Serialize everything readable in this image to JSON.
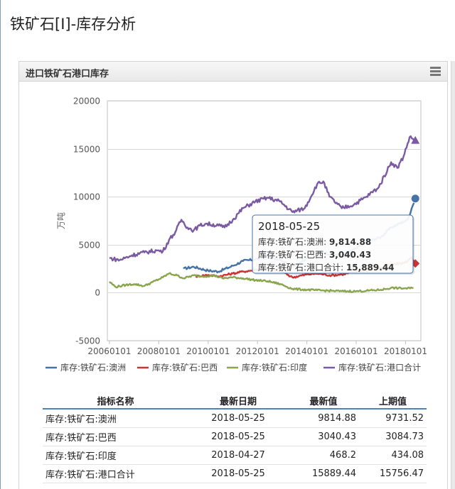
{
  "page": {
    "title": "铁矿石[I]-库存分析"
  },
  "panel": {
    "title": "进口铁矿石港口库存",
    "menu_icon": "menu-icon"
  },
  "chart_data": {
    "type": "line",
    "ylabel": "万吨",
    "ylim": [
      -5000,
      20000
    ],
    "yticks": [
      -5000,
      0,
      5000,
      10000,
      15000,
      20000
    ],
    "xlim": [
      "2005-12-01",
      "2018-08-15"
    ],
    "xticks": [
      "20060101",
      "20080101",
      "20100101",
      "20120101",
      "20140101",
      "20160101",
      "20180101"
    ],
    "grid": true,
    "legend_position": "bottom",
    "series": [
      {
        "name": "库存:铁矿石:澳洲",
        "color": "#4572a7",
        "marker": "circle",
        "points": [
          [
            "2009-01-01",
            2500
          ],
          [
            "2009-06-01",
            2700
          ],
          [
            "2010-01-01",
            2300
          ],
          [
            "2010-06-01",
            2200
          ],
          [
            "2011-01-01",
            2800
          ],
          [
            "2011-06-01",
            3300
          ],
          [
            "2012-01-01",
            3500
          ],
          [
            "2012-06-01",
            3800
          ],
          [
            "2013-01-01",
            3300
          ],
          [
            "2013-06-01",
            2700
          ],
          [
            "2014-01-01",
            3600
          ],
          [
            "2014-06-01",
            4300
          ],
          [
            "2015-01-01",
            4000
          ],
          [
            "2015-06-01",
            3900
          ],
          [
            "2016-01-01",
            4600
          ],
          [
            "2016-06-01",
            5300
          ],
          [
            "2017-01-01",
            5800
          ],
          [
            "2017-06-01",
            6800
          ],
          [
            "2017-12-01",
            7400
          ],
          [
            "2018-02-01",
            7600
          ],
          [
            "2018-04-01",
            8800
          ],
          [
            "2018-05-25",
            9814.88
          ]
        ]
      },
      {
        "name": "库存:铁矿石:巴西",
        "color": "#cc3333",
        "marker": "diamond",
        "points": [
          [
            "2009-07-01",
            1700
          ],
          [
            "2010-01-01",
            1850
          ],
          [
            "2010-06-01",
            1700
          ],
          [
            "2011-01-01",
            2000
          ],
          [
            "2011-06-01",
            2200
          ],
          [
            "2012-01-01",
            2400
          ],
          [
            "2012-06-01",
            2500
          ],
          [
            "2013-01-01",
            2200
          ],
          [
            "2013-06-01",
            1600
          ],
          [
            "2014-01-01",
            1900
          ],
          [
            "2014-06-01",
            2000
          ],
          [
            "2015-01-01",
            1800
          ],
          [
            "2015-06-01",
            1900
          ],
          [
            "2016-01-01",
            2200
          ],
          [
            "2016-06-01",
            2300
          ],
          [
            "2017-01-01",
            2600
          ],
          [
            "2017-06-01",
            2900
          ],
          [
            "2017-12-01",
            3100
          ],
          [
            "2018-02-01",
            3300
          ],
          [
            "2018-04-01",
            3700
          ],
          [
            "2018-05-25",
            3040.43
          ]
        ]
      },
      {
        "name": "库存:铁矿石:印度",
        "color": "#89a54e",
        "marker": "none",
        "points": [
          [
            "2006-01-01",
            1150
          ],
          [
            "2006-04-01",
            600
          ],
          [
            "2006-09-01",
            800
          ],
          [
            "2007-01-01",
            900
          ],
          [
            "2007-06-01",
            700
          ],
          [
            "2007-10-01",
            1100
          ],
          [
            "2008-03-01",
            1600
          ],
          [
            "2008-06-01",
            2000
          ],
          [
            "2008-10-01",
            1800
          ],
          [
            "2009-01-01",
            1500
          ],
          [
            "2009-06-01",
            1800
          ],
          [
            "2009-10-01",
            1700
          ],
          [
            "2010-04-01",
            1800
          ],
          [
            "2010-08-01",
            1500
          ],
          [
            "2011-01-01",
            1600
          ],
          [
            "2011-06-01",
            1500
          ],
          [
            "2011-12-01",
            1300
          ],
          [
            "2012-06-01",
            1200
          ],
          [
            "2012-12-01",
            900
          ],
          [
            "2013-06-01",
            400
          ],
          [
            "2014-01-01",
            300
          ],
          [
            "2014-06-01",
            250
          ],
          [
            "2015-01-01",
            200
          ],
          [
            "2015-06-01",
            150
          ],
          [
            "2016-01-01",
            150
          ],
          [
            "2016-06-01",
            200
          ],
          [
            "2017-01-01",
            300
          ],
          [
            "2017-06-01",
            500
          ],
          [
            "2017-12-01",
            450
          ],
          [
            "2018-04-27",
            468.2
          ]
        ]
      },
      {
        "name": "库存:铁矿石:港口合计",
        "color": "#7a5aa3",
        "marker": "triangle",
        "points": [
          [
            "2006-01-01",
            3600
          ],
          [
            "2006-06-01",
            3400
          ],
          [
            "2006-12-01",
            3900
          ],
          [
            "2007-06-01",
            4200
          ],
          [
            "2007-12-01",
            4400
          ],
          [
            "2008-03-01",
            4300
          ],
          [
            "2008-06-01",
            5500
          ],
          [
            "2008-09-01",
            6300
          ],
          [
            "2008-12-01",
            7600
          ],
          [
            "2009-03-01",
            6800
          ],
          [
            "2009-06-01",
            6500
          ],
          [
            "2009-09-01",
            7000
          ],
          [
            "2009-12-01",
            7200
          ],
          [
            "2010-06-01",
            7000
          ],
          [
            "2010-09-01",
            6800
          ],
          [
            "2011-01-01",
            7600
          ],
          [
            "2011-06-01",
            8800
          ],
          [
            "2011-12-01",
            9500
          ],
          [
            "2012-06-01",
            9900
          ],
          [
            "2012-12-01",
            9500
          ],
          [
            "2013-06-01",
            8400
          ],
          [
            "2013-12-01",
            8800
          ],
          [
            "2014-06-01",
            11300
          ],
          [
            "2014-09-01",
            11600
          ],
          [
            "2014-12-01",
            10000
          ],
          [
            "2015-06-01",
            8800
          ],
          [
            "2015-12-01",
            9200
          ],
          [
            "2016-06-01",
            10000
          ],
          [
            "2016-12-01",
            11000
          ],
          [
            "2017-06-01",
            13600
          ],
          [
            "2017-09-01",
            13000
          ],
          [
            "2017-12-01",
            14200
          ],
          [
            "2018-03-01",
            16200
          ],
          [
            "2018-05-25",
            15889.44
          ]
        ]
      }
    ]
  },
  "tooltip": {
    "date": "2018-05-25",
    "rows": [
      {
        "label": "库存:铁矿石:澳洲:",
        "value": "9,814.88"
      },
      {
        "label": "库存:铁矿石:巴西:",
        "value": "3,040.43"
      },
      {
        "label": "库存:铁矿石:港口合计:",
        "value": "15,889.44"
      }
    ]
  },
  "table": {
    "headers": [
      "指标名称",
      "最新日期",
      "最新值",
      "上期值"
    ],
    "rows": [
      [
        "库存:铁矿石:澳洲",
        "2018-05-25",
        "9814.88",
        "9731.52"
      ],
      [
        "库存:铁矿石:巴西",
        "2018-05-25",
        "3040.43",
        "3084.73"
      ],
      [
        "库存:铁矿石:印度",
        "2018-04-27",
        "468.2",
        "434.08"
      ],
      [
        "库存:铁矿石:港口合计",
        "2018-05-25",
        "15889.44",
        "15756.47"
      ]
    ]
  }
}
